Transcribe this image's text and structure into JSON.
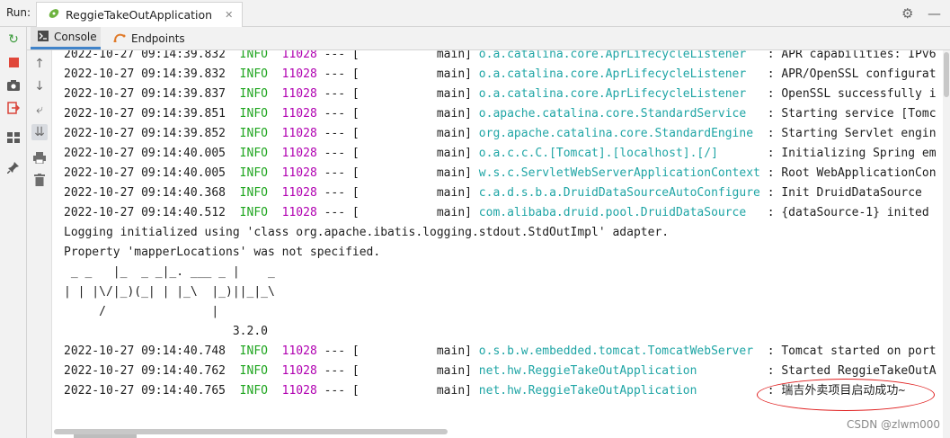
{
  "toolbar": {
    "run_label": "Run:",
    "tab_title": "ReggieTakeOutApplication",
    "close_glyph": "✕"
  },
  "subtabs": [
    {
      "label": "Console",
      "icon": "console-icon"
    },
    {
      "label": "Endpoints",
      "icon": "endpoints-icon"
    }
  ],
  "colors": {
    "info": "#1fa51f",
    "pid": "#b000b0",
    "logger": "#1fa5a5",
    "highlight_ellipse": "#e02020",
    "active_tab_underline": "#4083c9"
  },
  "console_lines": [
    {
      "type": "log",
      "ts": "2022-10-27 09:14:39.832",
      "level": "INFO",
      "pid": "11028",
      "mid": " --- [           main] ",
      "logger": "o.a.catalina.core.AprLifecycleListener  ",
      "msg": " : APR capabilities: IPv6"
    },
    {
      "type": "log",
      "ts": "2022-10-27 09:14:39.832",
      "level": "INFO",
      "pid": "11028",
      "mid": " --- [           main] ",
      "logger": "o.a.catalina.core.AprLifecycleListener  ",
      "msg": " : APR/OpenSSL configurat"
    },
    {
      "type": "log",
      "ts": "2022-10-27 09:14:39.837",
      "level": "INFO",
      "pid": "11028",
      "mid": " --- [           main] ",
      "logger": "o.a.catalina.core.AprLifecycleListener  ",
      "msg": " : OpenSSL successfully i"
    },
    {
      "type": "log",
      "ts": "2022-10-27 09:14:39.851",
      "level": "INFO",
      "pid": "11028",
      "mid": " --- [           main] ",
      "logger": "o.apache.catalina.core.StandardService  ",
      "msg": " : Starting service [Tomc"
    },
    {
      "type": "log",
      "ts": "2022-10-27 09:14:39.852",
      "level": "INFO",
      "pid": "11028",
      "mid": " --- [           main] ",
      "logger": "org.apache.catalina.core.StandardEngine ",
      "msg": " : Starting Servlet engin"
    },
    {
      "type": "log",
      "ts": "2022-10-27 09:14:40.005",
      "level": "INFO",
      "pid": "11028",
      "mid": " --- [           main] ",
      "logger": "o.a.c.c.C.[Tomcat].[localhost].[/]      ",
      "msg": " : Initializing Spring em"
    },
    {
      "type": "log",
      "ts": "2022-10-27 09:14:40.005",
      "level": "INFO",
      "pid": "11028",
      "mid": " --- [           main] ",
      "logger": "w.s.c.ServletWebServerApplicationContext",
      "msg": " : Root WebApplicationCon"
    },
    {
      "type": "log",
      "ts": "2022-10-27 09:14:40.368",
      "level": "INFO",
      "pid": "11028",
      "mid": " --- [           main] ",
      "logger": "c.a.d.s.b.a.DruidDataSourceAutoConfigure",
      "msg": " : Init DruidDataSource"
    },
    {
      "type": "log",
      "ts": "2022-10-27 09:14:40.512",
      "level": "INFO",
      "pid": "11028",
      "mid": " --- [           main] ",
      "logger": "com.alibaba.druid.pool.DruidDataSource  ",
      "msg": " : {dataSource-1} inited"
    },
    {
      "type": "plain",
      "text": "Logging initialized using 'class org.apache.ibatis.logging.stdout.StdOutImpl' adapter."
    },
    {
      "type": "plain",
      "text": "Property 'mapperLocations' was not specified."
    },
    {
      "type": "plain",
      "text": " _ _   |_  _ _|_. ___ _ |    _ "
    },
    {
      "type": "plain",
      "text": "| | |\\/|_)(_| | |_\\  |_)||_|_\\ "
    },
    {
      "type": "plain",
      "text": "     /               |         "
    },
    {
      "type": "plain",
      "text": "                        3.2.0 "
    },
    {
      "type": "log",
      "ts": "2022-10-27 09:14:40.748",
      "level": "INFO",
      "pid": "11028",
      "mid": " --- [           main] ",
      "logger": "o.s.b.w.embedded.tomcat.TomcatWebServer ",
      "msg": " : Tomcat started on port"
    },
    {
      "type": "log",
      "ts": "2022-10-27 09:14:40.762",
      "level": "INFO",
      "pid": "11028",
      "mid": " --- [           main] ",
      "logger": "net.hw.ReggieTakeOutApplication         ",
      "msg": " : Started ReggieTakeOutA"
    },
    {
      "type": "log",
      "ts": "2022-10-27 09:14:40.765",
      "level": "INFO",
      "pid": "11028",
      "mid": " --- [           main] ",
      "logger": "net.hw.ReggieTakeOutApplication         ",
      "msg": " : 瑞吉外卖项目启动成功~"
    }
  ],
  "watermark": "CSDN @zlwm000"
}
